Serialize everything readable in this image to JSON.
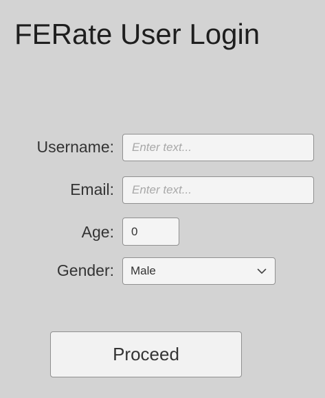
{
  "title": "FERate User Login",
  "form": {
    "username": {
      "label": "Username:",
      "value": "",
      "placeholder": "Enter text..."
    },
    "email": {
      "label": "Email:",
      "value": "",
      "placeholder": "Enter text..."
    },
    "age": {
      "label": "Age:",
      "value": "0"
    },
    "gender": {
      "label": "Gender:",
      "selected": "Male",
      "icon": "chevron-down-icon"
    }
  },
  "proceed_label": "Proceed"
}
